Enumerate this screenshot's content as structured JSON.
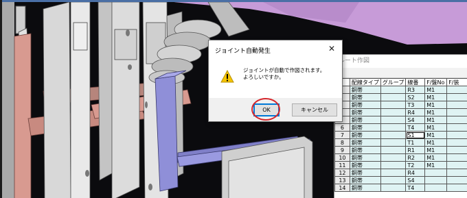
{
  "dialog": {
    "title": "ジョイント自動発生",
    "close_glyph": "✕",
    "message_line1": "ジョイントが自動で作図されます。",
    "message_line2": "よろしいですか。",
    "ok_label": "OK",
    "cancel_label": "キャンセル"
  },
  "table_window": {
    "title": "ルート作図",
    "headers": [
      "",
      "配線タイプ",
      "グループ",
      "線番",
      "F/盤No",
      "F/装"
    ],
    "rows": [
      {
        "no": "",
        "type": "銅帯",
        "group": "",
        "wire": "R3",
        "panel": "M1",
        "dev": ""
      },
      {
        "no": "",
        "type": "銅帯",
        "group": "",
        "wire": "S2",
        "panel": "M1",
        "dev": ""
      },
      {
        "no": "",
        "type": "銅帯",
        "group": "",
        "wire": "T3",
        "panel": "M1",
        "dev": ""
      },
      {
        "no": "",
        "type": "銅帯",
        "group": "",
        "wire": "R4",
        "panel": "M1",
        "dev": ""
      },
      {
        "no": "",
        "type": "銅帯",
        "group": "",
        "wire": "S4",
        "panel": "M1",
        "dev": ""
      },
      {
        "no": "6",
        "type": "銅帯",
        "group": "",
        "wire": "T4",
        "panel": "M1",
        "dev": ""
      },
      {
        "no": "7",
        "type": "銅帯",
        "group": "",
        "wire": "S1",
        "panel": "M1",
        "dev": ""
      },
      {
        "no": "8",
        "type": "銅帯",
        "group": "",
        "wire": "T1",
        "panel": "M1",
        "dev": ""
      },
      {
        "no": "9",
        "type": "銅帯",
        "group": "",
        "wire": "R1",
        "panel": "M1",
        "dev": ""
      },
      {
        "no": "10",
        "type": "銅帯",
        "group": "",
        "wire": "R2",
        "panel": "M1",
        "dev": ""
      },
      {
        "no": "11",
        "type": "銅帯",
        "group": "",
        "wire": "T2",
        "panel": "M1",
        "dev": ""
      },
      {
        "no": "12",
        "type": "銅帯",
        "group": "",
        "wire": "R4",
        "panel": "",
        "dev": ""
      },
      {
        "no": "13",
        "type": "銅帯",
        "group": "",
        "wire": "S4",
        "panel": "",
        "dev": ""
      },
      {
        "no": "14",
        "type": "銅帯",
        "group": "",
        "wire": "T4",
        "panel": "",
        "dev": ""
      }
    ]
  },
  "colors": {
    "background": "#0b0b0e",
    "busbar_pink": "#d89a90",
    "busbar_blue": "#8f8fd8",
    "frame_grey": "#c9c9c9",
    "insulator_grey": "#b8b8b8",
    "magenta_panel": "#c79bd8",
    "cell_cyan": "#dff3f3",
    "highlight_red": "#d6262b",
    "focus_blue": "#0078d7"
  },
  "icons": {
    "warning": "warning-icon",
    "close": "close-icon"
  }
}
